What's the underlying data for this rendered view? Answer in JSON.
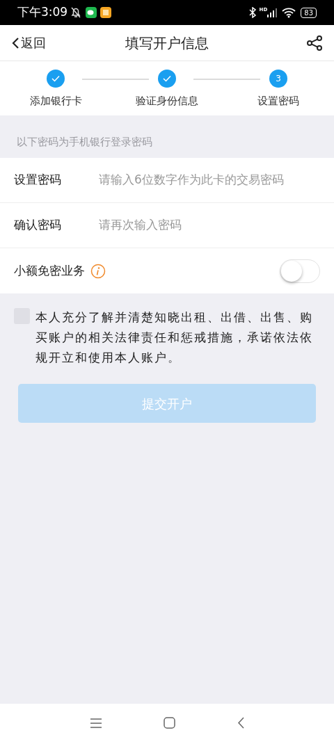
{
  "status_bar": {
    "time": "下午3:09",
    "network": "HD",
    "battery": "83"
  },
  "header": {
    "back": "返回",
    "title": "填写开户信息"
  },
  "steps": [
    {
      "label": "添加银行卡",
      "done": true
    },
    {
      "label": "验证身份信息",
      "done": true
    },
    {
      "label": "设置密码",
      "done": false,
      "number": "3"
    }
  ],
  "hint": "以下密码为手机银行登录密码",
  "fields": [
    {
      "label": "设置密码",
      "placeholder": "请输入6位数字作为此卡的交易密码"
    },
    {
      "label": "确认密码",
      "placeholder": "请再次输入密码"
    }
  ],
  "small_payment": {
    "label": "小额免密业务",
    "on": false
  },
  "agreement": {
    "checked": false,
    "text": "本人充分了解并清楚知晓出租、出借、出售、购买账户的相关法律责任和惩戒措施，承诺依法依规开立和使用本人账户。"
  },
  "submit": {
    "label": "提交开户",
    "disabled": true
  }
}
